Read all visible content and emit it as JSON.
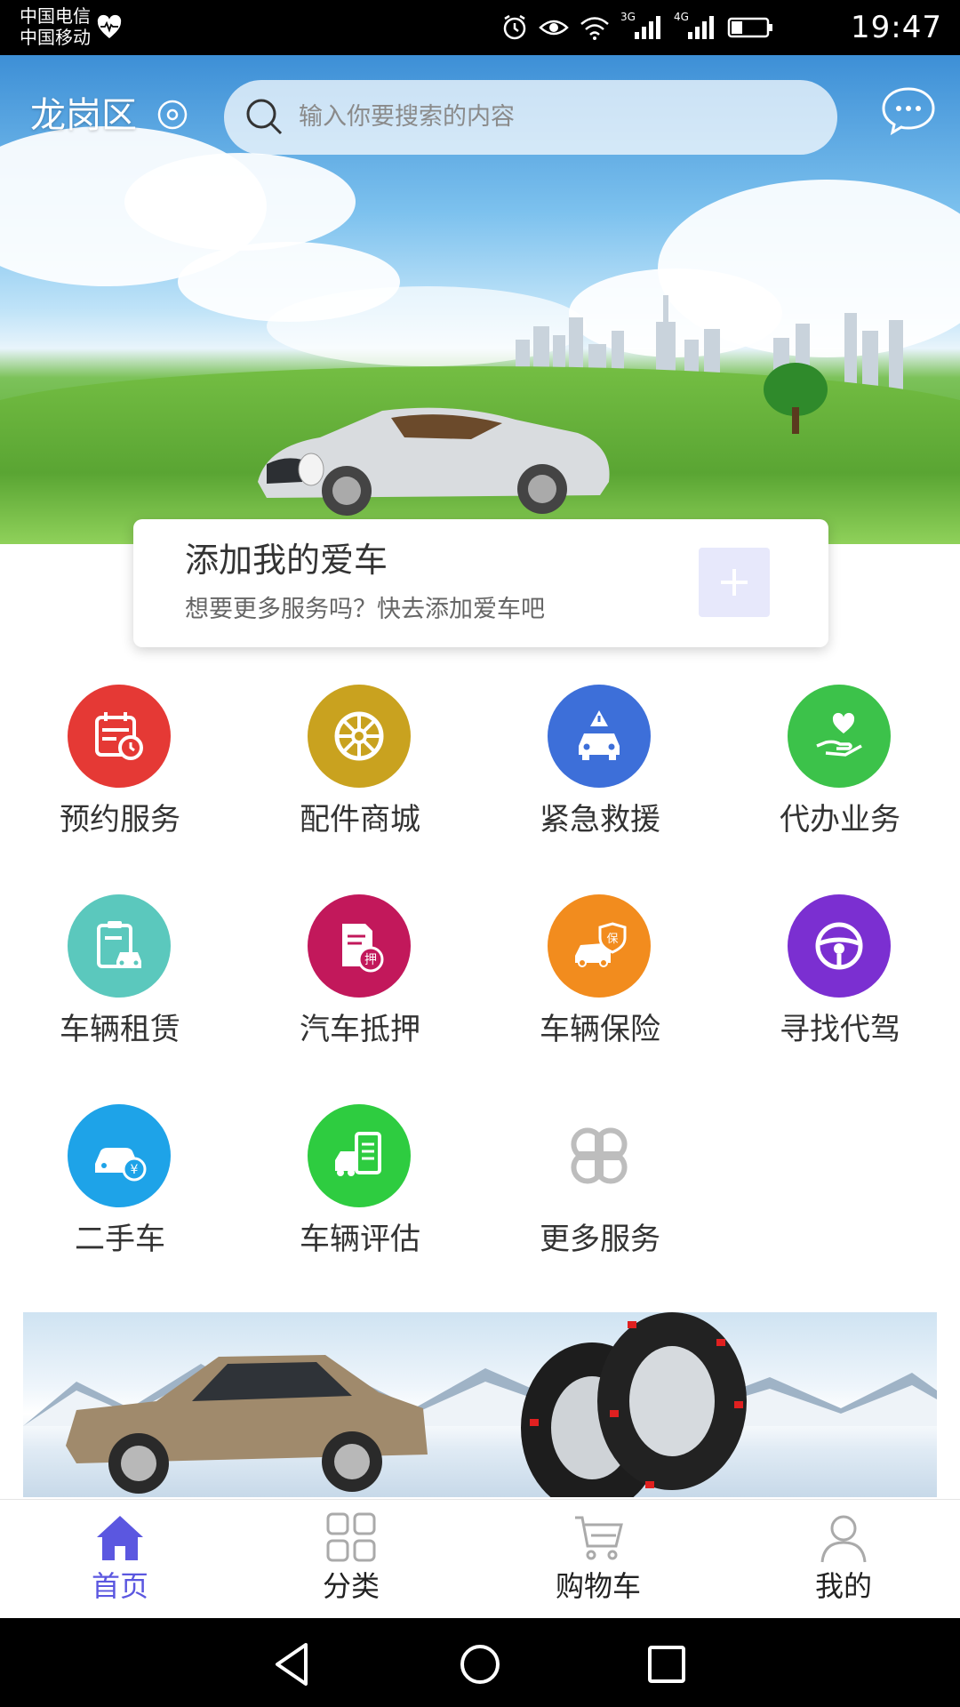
{
  "status_bar": {
    "carrier_1": "中国电信",
    "carrier_2": "中国移动",
    "net_3g": "3G",
    "net_4g": "4G",
    "time": "19:47"
  },
  "header": {
    "location": "龙岗区",
    "search_placeholder": "输入你要搜索的内容"
  },
  "add_car": {
    "title": "添加我的爱车",
    "subtitle": "想要更多服务吗？快去添加爱车吧"
  },
  "services": [
    {
      "label": "预约服务",
      "icon": "calendar-clock-icon",
      "color": "#e53935"
    },
    {
      "label": "配件商城",
      "icon": "wheel-icon",
      "color": "#c9a21f"
    },
    {
      "label": "紧急救援",
      "icon": "car-warning-icon",
      "color": "#3d6fd9"
    },
    {
      "label": "代办业务",
      "icon": "hand-heart-icon",
      "color": "#3cc24a"
    },
    {
      "label": "车辆租赁",
      "icon": "clipboard-car-icon",
      "color": "#5bc8bd"
    },
    {
      "label": "汽车抵押",
      "icon": "document-pledge-icon",
      "color": "#c2185b"
    },
    {
      "label": "车辆保险",
      "icon": "car-shield-icon",
      "color": "#f28c1e"
    },
    {
      "label": "寻找代驾",
      "icon": "steering-wheel-icon",
      "color": "#7b2fd1"
    },
    {
      "label": "二手车",
      "icon": "car-yuan-icon",
      "color": "#1ea3e8"
    },
    {
      "label": "车辆评估",
      "icon": "truck-list-icon",
      "color": "#2ecc40"
    },
    {
      "label": "更多服务",
      "icon": "more-grid-icon",
      "color": "#bdbdbd"
    }
  ],
  "pledge_badge": "押",
  "insurance_badge": "保",
  "yuan_badge": "¥",
  "bottom_nav": [
    {
      "label": "首页",
      "icon": "home-icon",
      "active": true
    },
    {
      "label": "分类",
      "icon": "category-grid-icon",
      "active": false
    },
    {
      "label": "购物车",
      "icon": "cart-icon",
      "active": false
    },
    {
      "label": "我的",
      "icon": "user-icon",
      "active": false
    }
  ],
  "colors": {
    "accent": "#5b57e0",
    "banner_dot": "#1f7fff",
    "add_button_bg": "#e7e8fb"
  }
}
